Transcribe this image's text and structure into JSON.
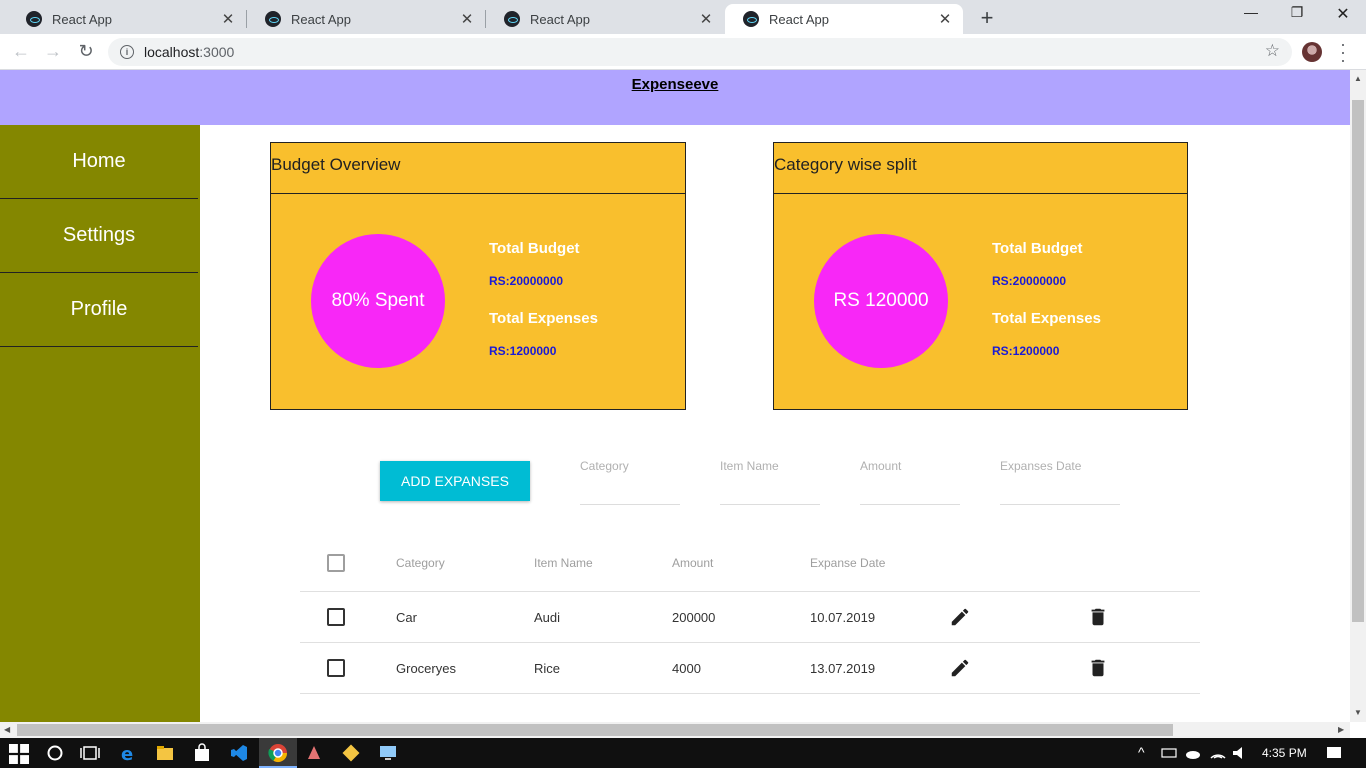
{
  "browser": {
    "tabs": [
      {
        "title": "React App",
        "active": false
      },
      {
        "title": "React App",
        "active": false
      },
      {
        "title": "React App",
        "active": false
      },
      {
        "title": "React App",
        "active": true
      }
    ],
    "url_host": "localhost",
    "url_port": ":3000"
  },
  "app": {
    "title": "Expenseeve"
  },
  "sidebar": {
    "items": [
      {
        "label": "Home"
      },
      {
        "label": "Settings"
      },
      {
        "label": "Profile"
      }
    ]
  },
  "cards": [
    {
      "title": "Budget Overview",
      "circle_text": "80% Spent",
      "budget_label": "Total Budget",
      "budget_value": "RS:20000000",
      "expenses_label": "Total Expenses",
      "expenses_value": "RS:1200000"
    },
    {
      "title": "Category wise split",
      "circle_text": "RS 120000",
      "budget_label": "Total Budget",
      "budget_value": "RS:20000000",
      "expenses_label": "Total Expenses",
      "expenses_value": "RS:1200000"
    }
  ],
  "form": {
    "add_button": "ADD EXPANSES",
    "fields": [
      {
        "label": "Category"
      },
      {
        "label": "Item Name"
      },
      {
        "label": "Amount"
      },
      {
        "label": "Expanses Date"
      }
    ]
  },
  "table": {
    "headers": {
      "category": "Category",
      "item": "Item Name",
      "amount": "Amount",
      "date": "Expanse Date"
    },
    "rows": [
      {
        "category": "Car",
        "item": "Audi",
        "amount": "200000",
        "date": "10.07.2019"
      },
      {
        "category": "Groceryes",
        "item": "Rice",
        "amount": "4000",
        "date": "13.07.2019"
      }
    ]
  },
  "taskbar": {
    "time": "4:35 PM"
  },
  "colors": {
    "header_bg": "#b0a4ff",
    "sidebar_bg": "#848700",
    "card_bg": "#f9bf2d",
    "circle": "#f827f7",
    "button": "#00bcd4"
  }
}
